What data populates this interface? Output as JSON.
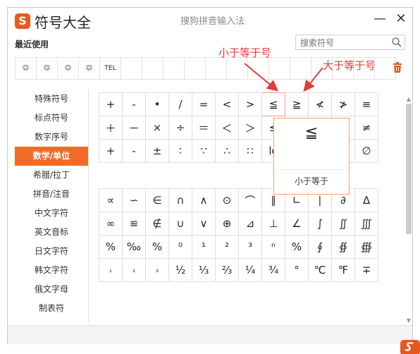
{
  "app": {
    "title": "符号大全",
    "center_title": "搜狗拼音输入法",
    "logo_char": "S",
    "minimize": "—",
    "close": "✕"
  },
  "search": {
    "placeholder": "搜索符号"
  },
  "recent": {
    "label": "最近使用",
    "items": [
      "☺",
      "☺",
      "☺",
      "☺",
      "TEL",
      "",
      "",
      "",
      "",
      "",
      "",
      "",
      "",
      "",
      "",
      "",
      "",
      ""
    ]
  },
  "sidebar": {
    "items": [
      "特殊符号",
      "标点符号",
      "数字序号",
      "数学/单位",
      "希腊/拉丁",
      "拼音/注音",
      "中文字符",
      "英文音标",
      "日文字符",
      "韩文字符",
      "俄文字母",
      "制表符"
    ],
    "active_index": 3
  },
  "grid1": [
    [
      "+",
      "-",
      "•",
      "/",
      "=",
      "<",
      ">",
      "≦",
      "≧",
      "≮",
      "≯",
      "≡"
    ],
    [
      "＋",
      "－",
      "×",
      "÷",
      "＝",
      "＜",
      "＞",
      "≤",
      "≥",
      "≈",
      "≒",
      "≠"
    ],
    [
      "+",
      "-",
      "±",
      "∶",
      "∵",
      "∴",
      "∷",
      "lo",
      "",
      "",
      "∏",
      "∅"
    ]
  ],
  "grid2": [
    [
      "∝",
      "∽",
      "∈",
      "∩",
      "∧",
      "⊙",
      "⌒",
      "∥",
      "∟",
      "∣",
      "∂",
      "∆"
    ],
    [
      "∞",
      "≌",
      "∉",
      "∪",
      "∨",
      "⊕",
      "⊿",
      "⊥",
      "∠",
      "∫",
      "∬",
      "∭"
    ],
    [
      "%",
      "‰",
      "%",
      "⁰",
      "¹",
      "²",
      "³",
      "ⁿ",
      "%",
      "∮",
      "∯",
      "∰"
    ],
    [
      "₁",
      "₂",
      "₃",
      "½",
      "⅓",
      "⅔",
      "¼",
      "¾",
      "°",
      "℃",
      "℉",
      "∓"
    ]
  ],
  "popup": {
    "symbol": "≦",
    "label": "小于等于"
  },
  "annotations": {
    "less_equal": "小于等于号",
    "greater_equal": "大于等于号"
  },
  "colors": {
    "accent": "#f26b2a",
    "annotation": "#e03c3c"
  }
}
